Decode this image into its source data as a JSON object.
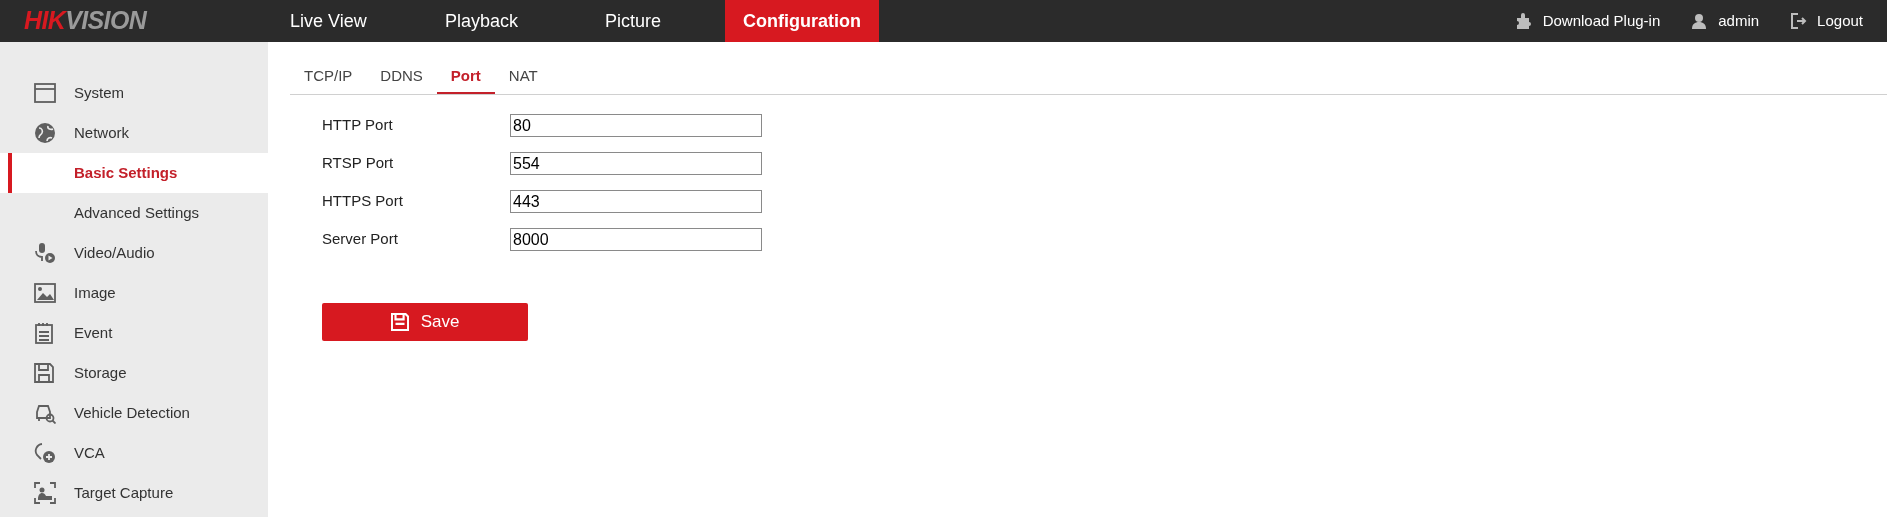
{
  "header": {
    "logo": [
      {
        "text": "HIK",
        "color": "#d71920"
      },
      {
        "text": "VISION",
        "color": "#9a9a9a"
      }
    ],
    "nav": [
      {
        "label": "Live View",
        "selected": false
      },
      {
        "label": "Playback",
        "selected": false
      },
      {
        "label": "Picture",
        "selected": false
      },
      {
        "label": "Configuration",
        "selected": true
      }
    ],
    "actions": [
      "Download Plug-in",
      "admin",
      "Logout"
    ]
  },
  "sidebar": {
    "items": [
      {
        "label": "System",
        "selected": false
      },
      {
        "label": "Network",
        "selected": false,
        "children": [
          {
            "label": "Basic Settings",
            "selected": true
          },
          {
            "label": "Advanced Settings",
            "selected": false
          }
        ]
      },
      {
        "label": "Video/Audio",
        "selected": false
      },
      {
        "label": "Image",
        "selected": false
      },
      {
        "label": "Event",
        "selected": false
      },
      {
        "label": "Storage",
        "selected": false
      },
      {
        "label": "Vehicle Detection",
        "selected": false
      },
      {
        "label": "VCA",
        "selected": false
      },
      {
        "label": "Target Capture",
        "selected": false
      }
    ]
  },
  "tabs": [
    {
      "label": "TCP/IP",
      "selected": false
    },
    {
      "label": "DDNS",
      "selected": false
    },
    {
      "label": "Port",
      "selected": true
    },
    {
      "label": "NAT",
      "selected": false
    }
  ],
  "form": {
    "fields": [
      {
        "label": "HTTP Port",
        "value": "80"
      },
      {
        "label": "RTSP Port",
        "value": "554"
      },
      {
        "label": "HTTPS Port",
        "value": "443"
      },
      {
        "label": "Server Port",
        "value": "8000"
      }
    ],
    "save_button": "Save"
  }
}
